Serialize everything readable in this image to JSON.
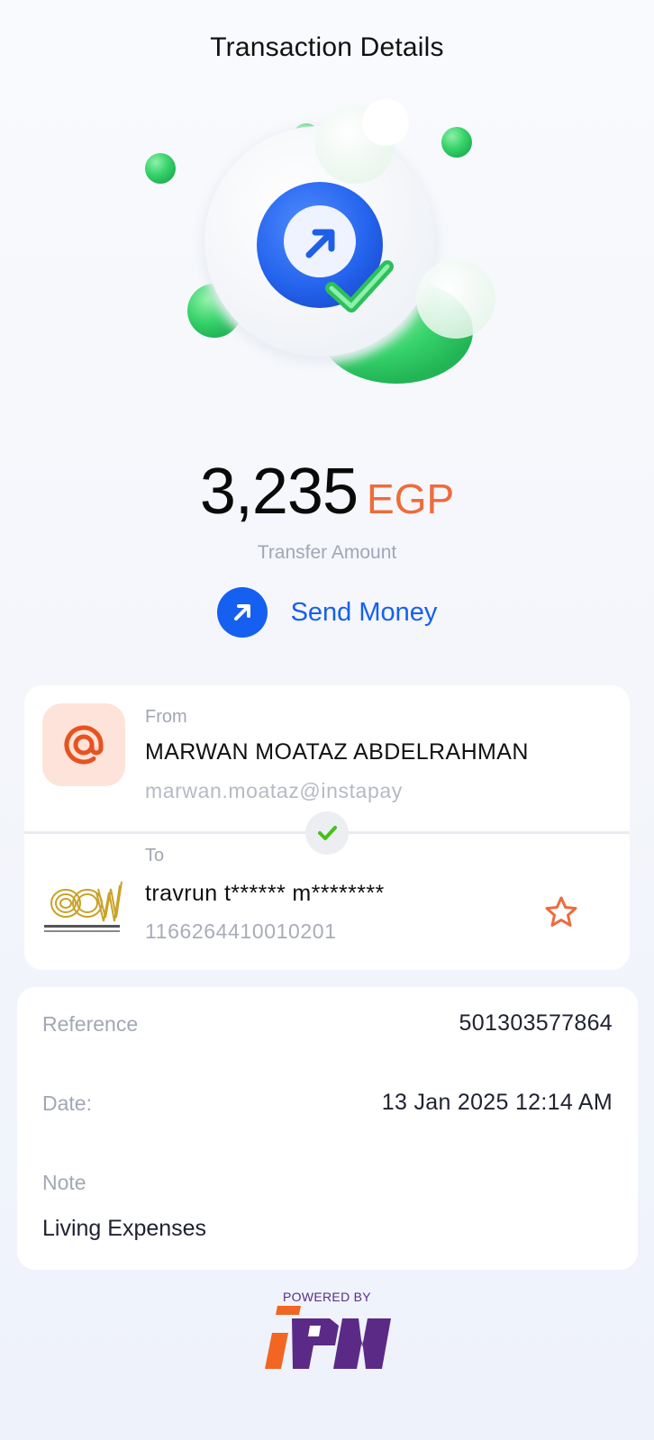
{
  "header": {
    "title": "Transaction Details"
  },
  "amount": {
    "value": "3,235",
    "currency": "EGP",
    "label": "Transfer Amount"
  },
  "transaction_type": {
    "label": "Send Money",
    "icon": "arrow-up-right-icon"
  },
  "from": {
    "label": "From",
    "name": "MARWAN MOATAZ ABDELRAHMAN",
    "handle": "marwan.moataz@instapay",
    "icon": "at-sign-icon"
  },
  "to": {
    "label": "To",
    "name": "travrun t****** m********",
    "account": "1166264410010201",
    "bank_logo": "arab-african-international-bank-logo"
  },
  "details": {
    "reference_label": "Reference",
    "reference_value": "501303577864",
    "date_label": "Date:",
    "date_value": "13 Jan 2025 12:14 AM",
    "note_label": "Note",
    "note_value": "Living Expenses"
  },
  "footer": {
    "powered_by": "POWERED BY",
    "brand": "IPN"
  },
  "colors": {
    "accent_blue": "#1560f0",
    "accent_orange": "#ee6b3b",
    "success_green": "#4cc36a",
    "brand_purple": "#5a2d84"
  }
}
